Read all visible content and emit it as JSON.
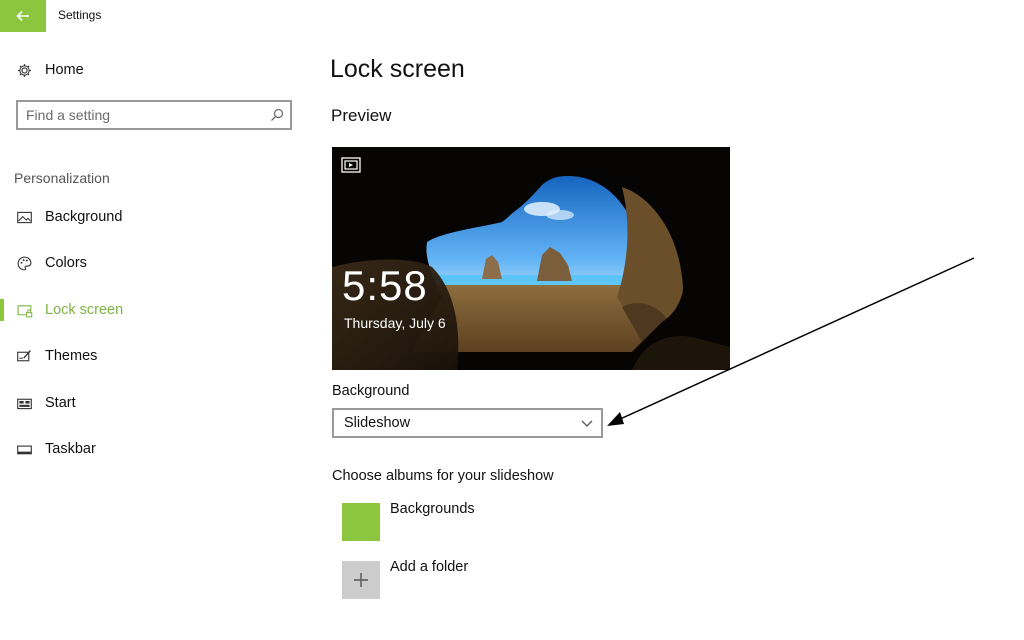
{
  "window": {
    "title": "Settings"
  },
  "sidebar": {
    "home_label": "Home",
    "search": {
      "placeholder": "Find a setting",
      "value": ""
    },
    "section_label": "Personalization",
    "items": [
      {
        "label": "Background",
        "icon": "picture-icon"
      },
      {
        "label": "Colors",
        "icon": "palette-icon"
      },
      {
        "label": "Lock screen",
        "icon": "lock-screen-icon",
        "active": true
      },
      {
        "label": "Themes",
        "icon": "themes-icon"
      },
      {
        "label": "Start",
        "icon": "start-icon"
      },
      {
        "label": "Taskbar",
        "icon": "taskbar-icon"
      }
    ]
  },
  "main": {
    "title": "Lock screen",
    "preview_heading": "Preview",
    "preview": {
      "time": "5:58",
      "date": "Thursday, July 6"
    },
    "background_label": "Background",
    "background_value": "Slideshow",
    "albums_label": "Choose albums for your slideshow",
    "albums": [
      {
        "name": "Backgrounds"
      },
      {
        "name": "Add a folder"
      }
    ]
  },
  "colors": {
    "accent": "#8cc63f"
  }
}
